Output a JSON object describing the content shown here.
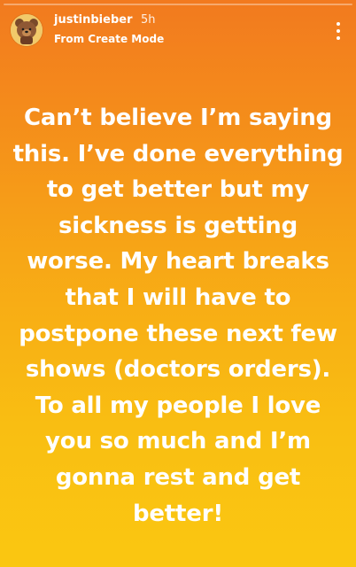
{
  "story": {
    "username": "justinbieber",
    "time_ago": "5h",
    "source_label": "From Create Mode",
    "avatar_icon": "bear-avatar-icon",
    "more_icon": "vertical-ellipsis-icon",
    "progress_fraction": 0.0,
    "caption_lines": [
      "Can’t believe I’m saying",
      "this. I’ve done everything",
      "to get better but my",
      "sickness is getting",
      "worse. My heart breaks",
      "that I will have to",
      "postpone these next few",
      "shows (doctors orders).",
      "To all my people I love",
      "you so much and I’m",
      "gonna rest and get",
      "better!"
    ]
  },
  "colors": {
    "background_top": "#f27a1f",
    "background_middle": "#f7a616",
    "background_bottom": "#fac711",
    "text": "#ffffff"
  }
}
